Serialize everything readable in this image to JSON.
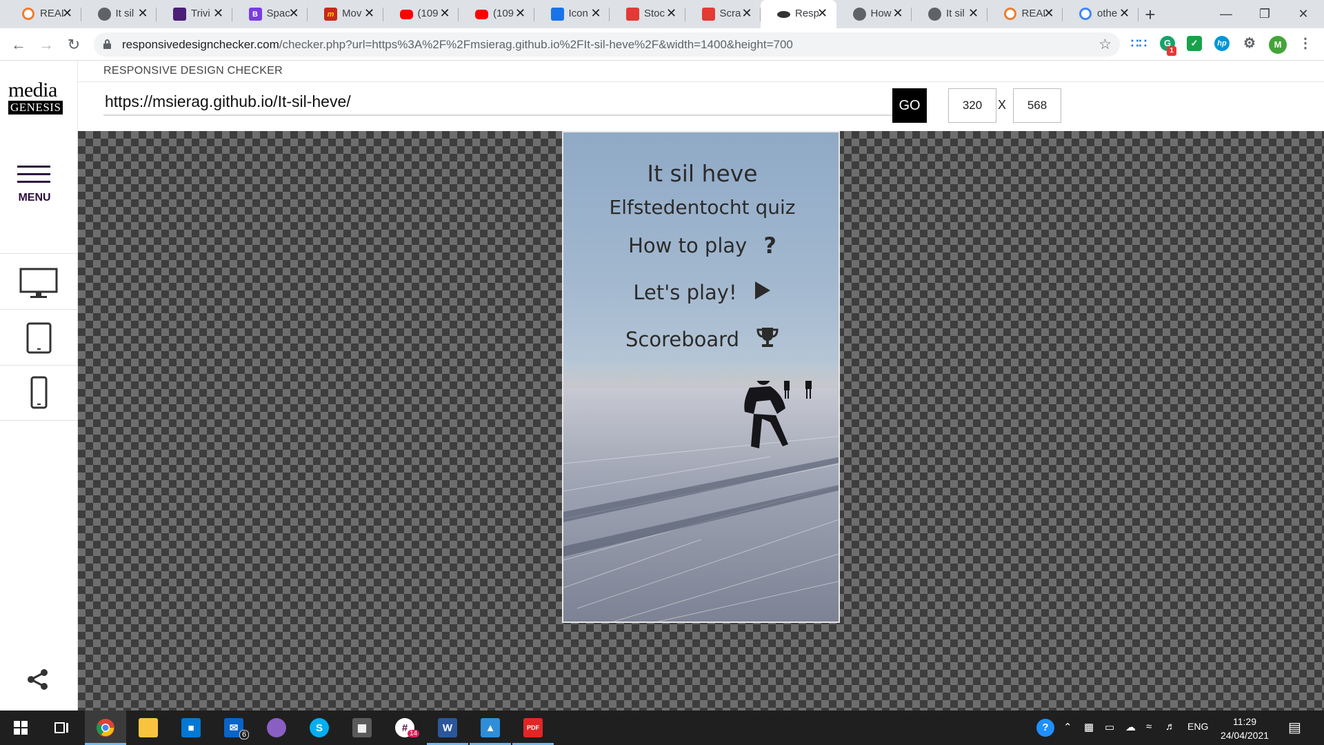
{
  "browser": {
    "tabs": [
      {
        "title": "REAL",
        "favicon": "g-orange-icon",
        "active": false
      },
      {
        "title": "It sil",
        "favicon": "globe-icon",
        "active": false
      },
      {
        "title": "Trivi",
        "favicon": "trivia-icon",
        "active": false
      },
      {
        "title": "Spac",
        "favicon": "b-purple-icon",
        "active": false
      },
      {
        "title": "Mov",
        "favicon": "m-icon",
        "active": false
      },
      {
        "title": "(109",
        "favicon": "youtube-icon",
        "active": false
      },
      {
        "title": "(109",
        "favicon": "youtube-icon",
        "active": false
      },
      {
        "title": "Icon",
        "favicon": "flag-icon",
        "active": false
      },
      {
        "title": "Stoc",
        "favicon": "red-square-icon",
        "active": false
      },
      {
        "title": "Scra",
        "favicon": "red-square-icon",
        "active": false
      },
      {
        "title": "Resp",
        "favicon": "responsive-icon",
        "active": true
      },
      {
        "title": "How",
        "favicon": "globe-icon",
        "active": false
      },
      {
        "title": "It sil",
        "favicon": "globe-icon",
        "active": false
      },
      {
        "title": "REAL",
        "favicon": "g-orange-icon",
        "active": false
      },
      {
        "title": "othe",
        "favicon": "google-icon",
        "active": false
      }
    ],
    "address": {
      "domain": "responsivedesignchecker.com",
      "path": "/checker.php?url=https%3A%2F%2Fmsierag.github.io%2FIt-sil-heve%2F&width=1400&height=700"
    },
    "profile_initial": "M",
    "extension_badge": "1"
  },
  "site": {
    "logo_line1": "media",
    "logo_line2": "GENESIS",
    "menu_label": "MENU",
    "header_title": "RESPONSIVE DESIGN CHECKER",
    "url_value": "https://msierag.github.io/It-sil-heve/",
    "go_label": "GO",
    "width_value": "320",
    "height_value": "568",
    "dim_separator": "X"
  },
  "app": {
    "title": "It sil heve",
    "subtitle": "Elfstedentocht quiz",
    "buttons": [
      {
        "label": "How to play",
        "icon": "question-icon"
      },
      {
        "label": "Let's play!",
        "icon": "play-icon"
      },
      {
        "label": "Scoreboard",
        "icon": "trophy-icon"
      }
    ]
  },
  "taskbar": {
    "mail_badge": "6",
    "slack_badge": "14",
    "language": "ENG",
    "time": "11:29",
    "date": "24/04/2021"
  },
  "colors": {
    "menu_purple": "#2d0e3f",
    "go_button": "#000000",
    "checker_dark": "#3d3d3d",
    "checker_light": "#6e6e6e",
    "taskbar": "#1f1f1f"
  }
}
